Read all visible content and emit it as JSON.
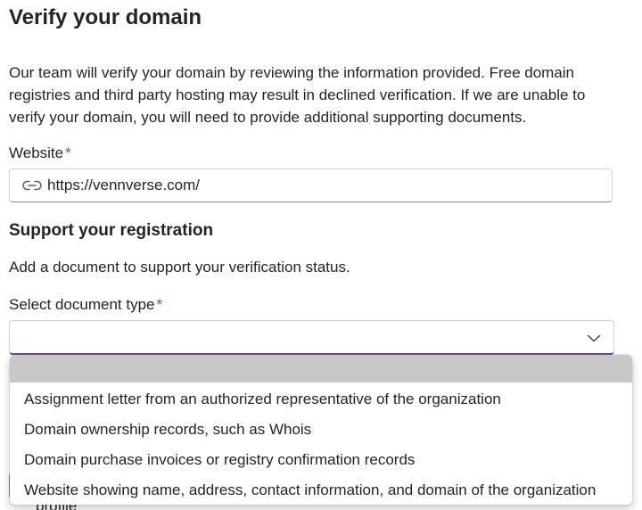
{
  "page": {
    "title": "Verify your domain",
    "intro": "Our team will verify your domain by reviewing the information provided. Free domain registries and third party hosting may result in declined verification. If we are unable to verify your domain, you will need to provide additional supporting documents."
  },
  "website": {
    "label": "Website",
    "required_mark": "*",
    "value": "https://vennverse.com/",
    "icon": "link-icon"
  },
  "support": {
    "title": "Support your registration",
    "description": "Add a document to support your verification status.",
    "doc_type_label": "Select document type",
    "required_mark": "*",
    "selected_value": "",
    "icon": "chevron-down-icon"
  },
  "dropdown": {
    "options": [
      "",
      "Assignment letter from an authorized representative of the organization",
      "Domain ownership records, such as Whois",
      "Domain purchase invoices or registry confirmation records",
      "Website showing name, address, contact information, and domain of the organization"
    ]
  },
  "behind": {
    "partial_text": "profile"
  },
  "colors": {
    "required": "#c4314b",
    "focus_underline": "#6b4ea8",
    "highlight": "#c7c7c7"
  }
}
